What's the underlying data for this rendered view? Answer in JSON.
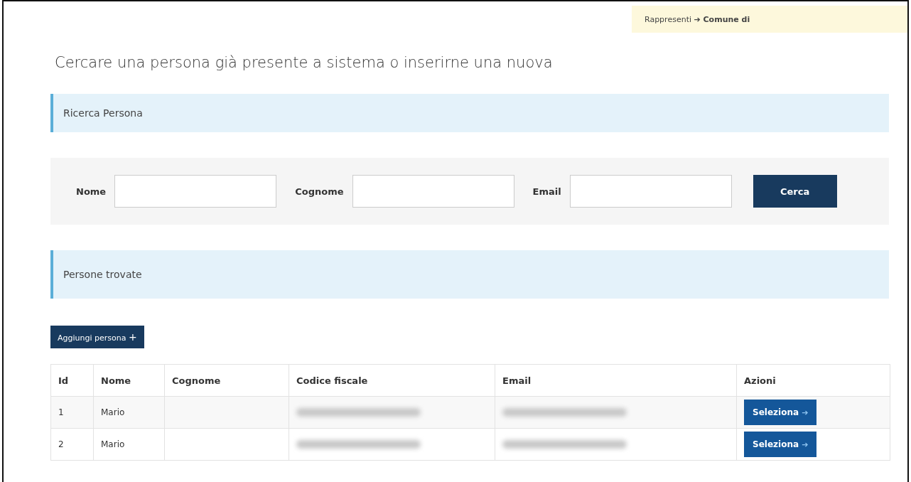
{
  "context_banner": {
    "from": "Rappresenti",
    "arrow": "➔",
    "to": "Comune di"
  },
  "title": "Cercare una persona già presente a sistema o inserirne una nuova",
  "search_section": {
    "heading": "Ricerca Persona",
    "fields": [
      {
        "label": "Nome"
      },
      {
        "label": "Cognome"
      },
      {
        "label": "Email"
      }
    ],
    "button": "Cerca"
  },
  "results_section": {
    "heading": "Persone trovate",
    "add_button": {
      "label": "Aggiungi persona",
      "icon": "+"
    }
  },
  "table": {
    "columns": [
      "Id",
      "Nome",
      "Cognome",
      "Codice fiscale",
      "Email",
      "Azioni"
    ],
    "rows": [
      {
        "id": "1",
        "nome": "Mario",
        "codice_fiscale_redacted": true,
        "email_redacted": true,
        "action": "Seleziona",
        "action_icon": "➔"
      },
      {
        "id": "2",
        "nome": "Mario",
        "codice_fiscale_redacted": true,
        "email_redacted": true,
        "action": "Seleziona",
        "action_icon": "➔"
      }
    ]
  }
}
